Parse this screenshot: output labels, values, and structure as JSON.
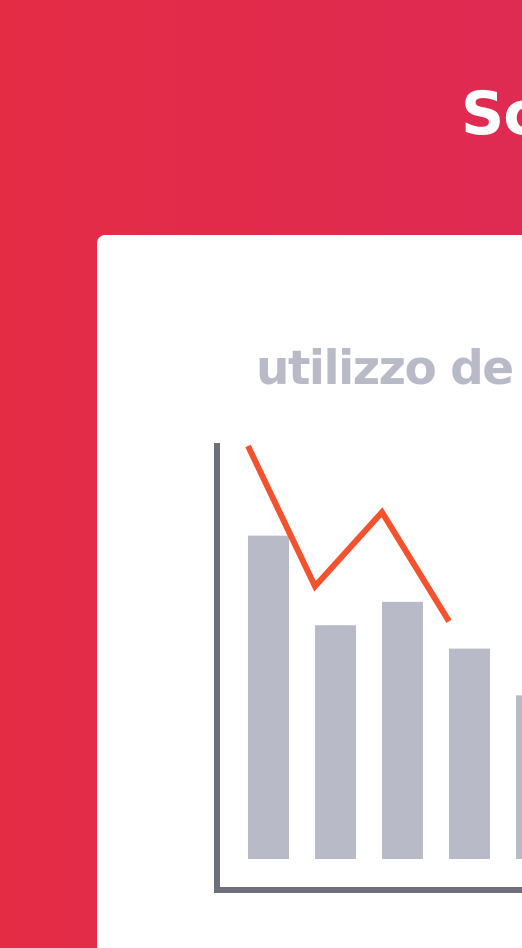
{
  "header": {
    "title": "Sc"
  },
  "card": {
    "title": "utilizzo de"
  },
  "colors": {
    "background_start": "#e42c45",
    "background_end": "#df2a52",
    "card_background": "#ffffff",
    "title_text": "#ffffff",
    "card_title_text": "#b9bac7",
    "bars": "#b9bac7",
    "trend_line": "#f4522f",
    "axis": "#6d6f7b"
  },
  "chart_data": {
    "type": "bar",
    "title": "",
    "xlabel": "",
    "ylabel": "",
    "categories": [
      "",
      "",
      "",
      "",
      ""
    ],
    "values": [
      83,
      60,
      66,
      54,
      42
    ],
    "line_series": {
      "name": "",
      "values": [
        106,
        70,
        89,
        61
      ]
    },
    "ylim": [
      0,
      106
    ],
    "grid": false
  }
}
